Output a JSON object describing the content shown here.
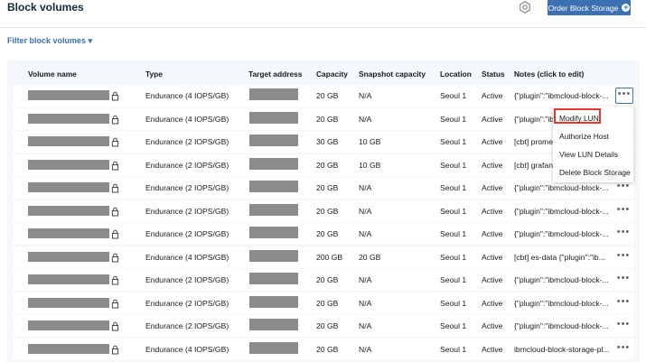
{
  "header": {
    "title": "Block volumes",
    "order_button_label": "Order Block Storage"
  },
  "filter": {
    "label": "Filter block volumes ▾"
  },
  "table": {
    "columns": [
      "Volume name",
      "Type",
      "Target address",
      "Capacity",
      "Snapshot capacity",
      "Location",
      "Status",
      "Notes (click to edit)"
    ],
    "rows": [
      {
        "type": "Endurance (4 IOPS/GB)",
        "capacity": "20 GB",
        "snapshot": "N/A",
        "location": "Seoul 1",
        "status": "Active",
        "notes": "{\"plugin\":\"ibmcloud-block-..."
      },
      {
        "type": "Endurance (4 IOPS/GB)",
        "capacity": "20 GB",
        "snapshot": "N/A",
        "location": "Seoul 1",
        "status": "Active",
        "notes": "{\"plugin\":\"ib"
      },
      {
        "type": "Endurance (2 IOPS/GB)",
        "capacity": "30 GB",
        "snapshot": "10 GB",
        "location": "Seoul 1",
        "status": "Active",
        "notes": "[cbt] promet"
      },
      {
        "type": "Endurance (2 IOPS/GB)",
        "capacity": "20 GB",
        "snapshot": "10 GB",
        "location": "Seoul 1",
        "status": "Active",
        "notes": "[cbt] grafana"
      },
      {
        "type": "Endurance (2 IOPS/GB)",
        "capacity": "20 GB",
        "snapshot": "N/A",
        "location": "Seoul 1",
        "status": "Active",
        "notes": "{\"plugin\":\"ibmcloud-block-..."
      },
      {
        "type": "Endurance (2 IOPS/GB)",
        "capacity": "20 GB",
        "snapshot": "N/A",
        "location": "Seoul 1",
        "status": "Active",
        "notes": "{\"plugin\":\"ibmcloud-block-..."
      },
      {
        "type": "Endurance (2 IOPS/GB)",
        "capacity": "20 GB",
        "snapshot": "N/A",
        "location": "Seoul 1",
        "status": "Active",
        "notes": "{\"plugin\":\"ibmcloud-block-..."
      },
      {
        "type": "Endurance (4 IOPS/GB)",
        "capacity": "200 GB",
        "snapshot": "20 GB",
        "location": "Seoul 1",
        "status": "Active",
        "notes": "[cbt] es-data {\"plugin\":\"ib..."
      },
      {
        "type": "Endurance (2 IOPS/GB)",
        "capacity": "20 GB",
        "snapshot": "N/A",
        "location": "Seoul 1",
        "status": "Active",
        "notes": "{\"plugin\":\"ibmcloud-block-..."
      },
      {
        "type": "Endurance (2 IOPS/GB)",
        "capacity": "20 GB",
        "snapshot": "N/A",
        "location": "Seoul 1",
        "status": "Active",
        "notes": "{\"plugin\":\"ibmcloud-block-..."
      },
      {
        "type": "Endurance (2 IOPS/GB)",
        "capacity": "20 GB",
        "snapshot": "N/A",
        "location": "Seoul 1",
        "status": "Active",
        "notes": "{\"plugin\":\"ibmcloud-block-..."
      },
      {
        "type": "Endurance (4 IOPS/GB)",
        "capacity": "20 GB",
        "snapshot": "N/A",
        "location": "Seoul 1",
        "status": "Active",
        "notes": "ibmcloud-block-storage-pl..."
      }
    ]
  },
  "overflow_menu": {
    "items": [
      "Modify LUN",
      "Authorize Host",
      "View LUN Details",
      "Delete Block Storage"
    ],
    "highlighted_item": "Modify LUN"
  },
  "icons": {
    "settings": "gear-icon",
    "add": "plus-circle-icon",
    "lock": "lock-icon",
    "overflow": "overflow-menu-icon"
  },
  "colors": {
    "accent": "#3d70b2",
    "highlight": "#e8362d",
    "table_bg": "#f4f7fb"
  }
}
